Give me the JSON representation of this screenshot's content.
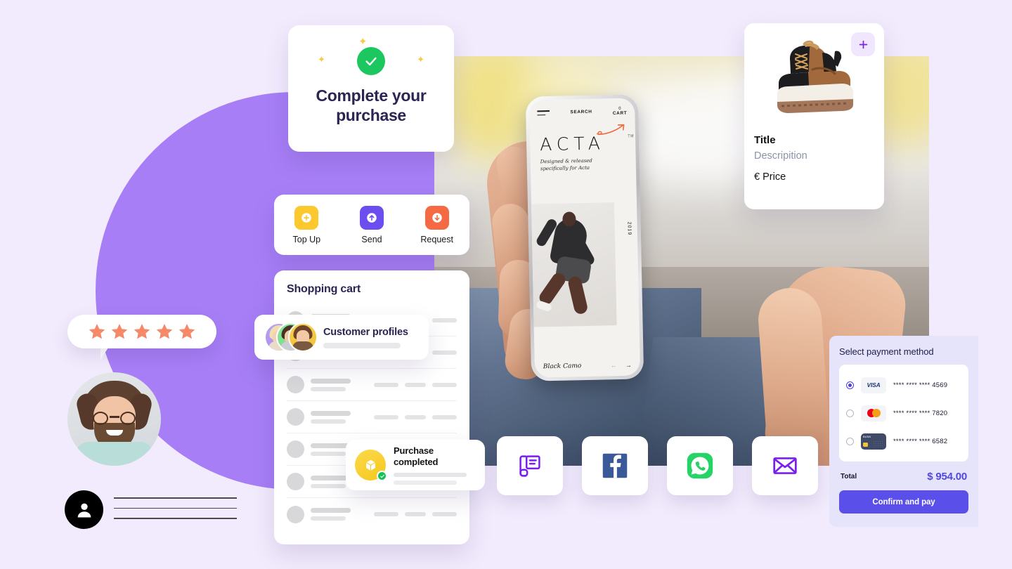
{
  "theme": {
    "background": "#f2ebfd",
    "circle_purple": "#a77ef6",
    "accent_indigo": "#5a4fe8",
    "green": "#1dc760",
    "yellow": "#fbc82e",
    "orange": "#f56a42"
  },
  "complete_purchase_card": {
    "icon": "green-check-circle-icon",
    "sparkles": [
      "sparkle-icon",
      "sparkle-icon",
      "sparkle-icon"
    ],
    "title": "Complete your purchase"
  },
  "quick_actions": {
    "items": [
      {
        "label": "Top Up",
        "icon": "plus-circle-icon",
        "color": "#fbc82e"
      },
      {
        "label": "Send",
        "icon": "arrow-up-circle-icon",
        "color": "#6c4ef0"
      },
      {
        "label": "Request",
        "icon": "arrow-down-circle-icon",
        "color": "#f56a42"
      }
    ]
  },
  "shopping_cart": {
    "title": "Shopping cart",
    "rows": [
      1,
      2,
      3,
      4,
      5,
      6,
      7
    ]
  },
  "customer_profiles": {
    "title": "Customer profiles",
    "avatar_count": 3
  },
  "purchase_completed": {
    "title": "Purchase completed",
    "icon": "package-box-icon",
    "badge": "check-badge-icon"
  },
  "product_card": {
    "add_icon": "plus-icon",
    "image": "brown-sneaker-boot",
    "title": "Title",
    "description": "Descripition",
    "price": "€ Price"
  },
  "phone_mockup": {
    "menu_icon": "hamburger-menu-icon",
    "search_label": "SEARCH",
    "cart_count": "0",
    "cart_label": "CART",
    "brand": "ACTA",
    "trademark": "TM",
    "tagline": "Designed & released specifically for Acta",
    "year": "2019",
    "product_name": "Black Camo",
    "prev_arrow": "←",
    "next_arrow": "→"
  },
  "review": {
    "stars": 5,
    "star_color": "#f58a68",
    "avatar": "person-portrait"
  },
  "user_row": {
    "icon": "user-avatar-icon",
    "line_count": 3
  },
  "share_icons": [
    {
      "name": "document-copy-icon",
      "color": "#7b1ff0"
    },
    {
      "name": "facebook-icon",
      "color": "#3b5998"
    },
    {
      "name": "whatsapp-icon",
      "color": "#25d366"
    },
    {
      "name": "email-envelope-icon",
      "color": "#7b1ff0"
    }
  ],
  "payment_panel": {
    "title": "Select payment method",
    "methods": [
      {
        "brand": "VISA",
        "number": "**** **** **** 4569",
        "selected": true
      },
      {
        "brand": "Mastercard",
        "number": "**** **** **** 7820",
        "selected": false
      },
      {
        "brand": "BANK",
        "number": "**** **** **** 6582",
        "selected": false
      }
    ],
    "total_label": "Total",
    "total_value": "$ 954.00",
    "confirm_label": "Confirm and pay"
  }
}
